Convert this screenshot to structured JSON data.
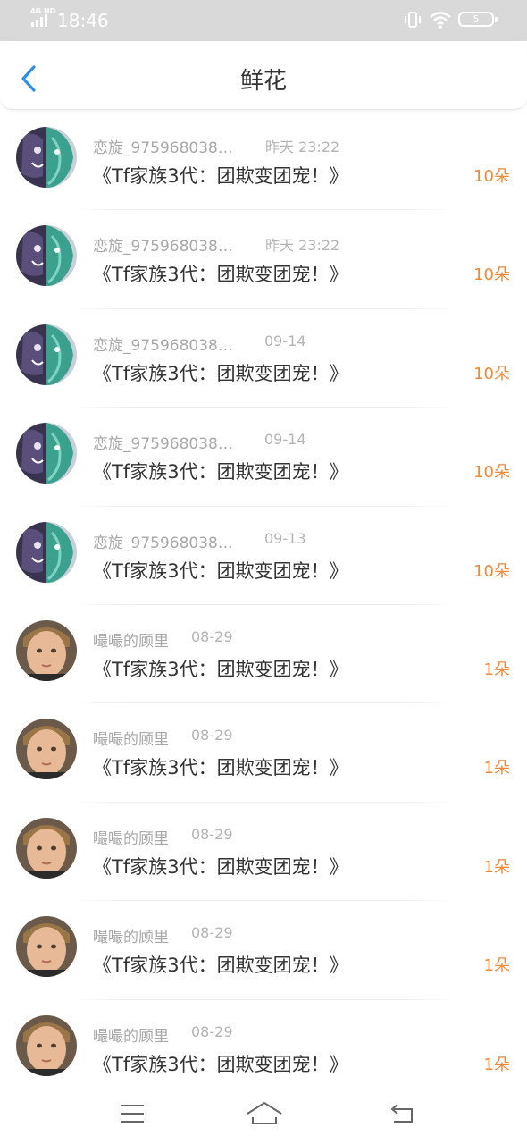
{
  "status_bar": {
    "network": "4G HD",
    "time": "18:46",
    "battery": "5"
  },
  "header": {
    "title": "鲜花"
  },
  "items": [
    {
      "name": "恋旋_975968038…",
      "time": "昨天 23:22",
      "book": "《Tf家族3代：团欺变团宠！》",
      "count": "10朵",
      "avatar": "anime-avatar"
    },
    {
      "name": "恋旋_975968038…",
      "time": "昨天 23:22",
      "book": "《Tf家族3代：团欺变团宠！》",
      "count": "10朵",
      "avatar": "anime-avatar"
    },
    {
      "name": "恋旋_975968038…",
      "time": "09-14",
      "book": "《Tf家族3代：团欺变团宠！》",
      "count": "10朵",
      "avatar": "anime-avatar"
    },
    {
      "name": "恋旋_975968038…",
      "time": "09-14",
      "book": "《Tf家族3代：团欺变团宠！》",
      "count": "10朵",
      "avatar": "anime-avatar"
    },
    {
      "name": "恋旋_975968038…",
      "time": "09-13",
      "book": "《Tf家族3代：团欺变团宠！》",
      "count": "10朵",
      "avatar": "anime-avatar"
    },
    {
      "name": "嘬嘬的顾里",
      "time": "08-29",
      "book": "《Tf家族3代：团欺变团宠！》",
      "count": "1朵",
      "avatar": "child-photo-avatar"
    },
    {
      "name": "嘬嘬的顾里",
      "time": "08-29",
      "book": "《Tf家族3代：团欺变团宠！》",
      "count": "1朵",
      "avatar": "child-photo-avatar"
    },
    {
      "name": "嘬嘬的顾里",
      "time": "08-29",
      "book": "《Tf家族3代：团欺变团宠！》",
      "count": "1朵",
      "avatar": "child-photo-avatar"
    },
    {
      "name": "嘬嘬的顾里",
      "time": "08-29",
      "book": "《Tf家族3代：团欺变团宠！》",
      "count": "1朵",
      "avatar": "child-photo-avatar"
    },
    {
      "name": "嘬嘬的顾里",
      "time": "08-29",
      "book": "《Tf家族3代：团欺变团宠！》",
      "count": "1朵",
      "avatar": "child-photo-avatar"
    }
  ],
  "colors": {
    "accent_back": "#2d8fe8",
    "count": "#ee8a3a",
    "muted_text": "#a8a8a8"
  },
  "nav_icons": [
    "menu-icon",
    "home-icon",
    "back-icon"
  ]
}
